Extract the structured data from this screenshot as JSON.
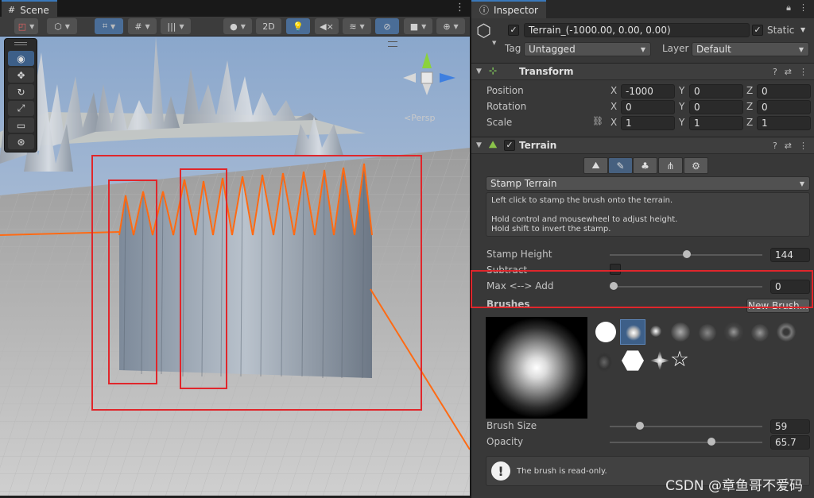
{
  "scene": {
    "tab_label": "Scene",
    "toolbar": {
      "btn_2d": "2D"
    },
    "persp_label": "<Persp"
  },
  "inspector": {
    "tab_label": "Inspector",
    "object": {
      "name": "Terrain_(-1000.00, 0.00, 0.00)",
      "static_label": "Static",
      "tag_label": "Tag",
      "tag_value": "Untagged",
      "layer_label": "Layer",
      "layer_value": "Default"
    },
    "transform": {
      "title": "Transform",
      "position_label": "Position",
      "rotation_label": "Rotation",
      "scale_label": "Scale",
      "axis_x": "X",
      "axis_y": "Y",
      "axis_z": "Z",
      "position": [
        "-1000",
        "0",
        "0"
      ],
      "rotation": [
        "0",
        "0",
        "0"
      ],
      "scale": [
        "1",
        "1",
        "1"
      ]
    },
    "terrain": {
      "title": "Terrain",
      "mode": "Stamp Terrain",
      "help_line1": "Left click to stamp the brush onto the terrain.",
      "help_line2": "Hold control and mousewheel to adjust height.",
      "help_line3": "Hold shift to invert the stamp.",
      "stamp_height_label": "Stamp Height",
      "stamp_height_value": "144",
      "stamp_height_fraction": 0.48,
      "subtract_label": "Subtract",
      "max_add_label": "Max <--> Add",
      "max_add_value": "0",
      "max_add_fraction": 0.0,
      "brushes_label": "Brushes",
      "new_brush_label": "New Brush...",
      "brush_size_label": "Brush Size",
      "brush_size_value": "59",
      "brush_size_fraction": 0.17,
      "opacity_label": "Opacity",
      "opacity_value": "65.7",
      "opacity_fraction": 0.64,
      "readonly_note": "The brush is read-only."
    }
  },
  "watermark": "CSDN @章鱼哥不爱码",
  "colors": {
    "accent": "#3a79bb",
    "highlight": "#e0262b",
    "selection_outline": "#ff6a13"
  }
}
